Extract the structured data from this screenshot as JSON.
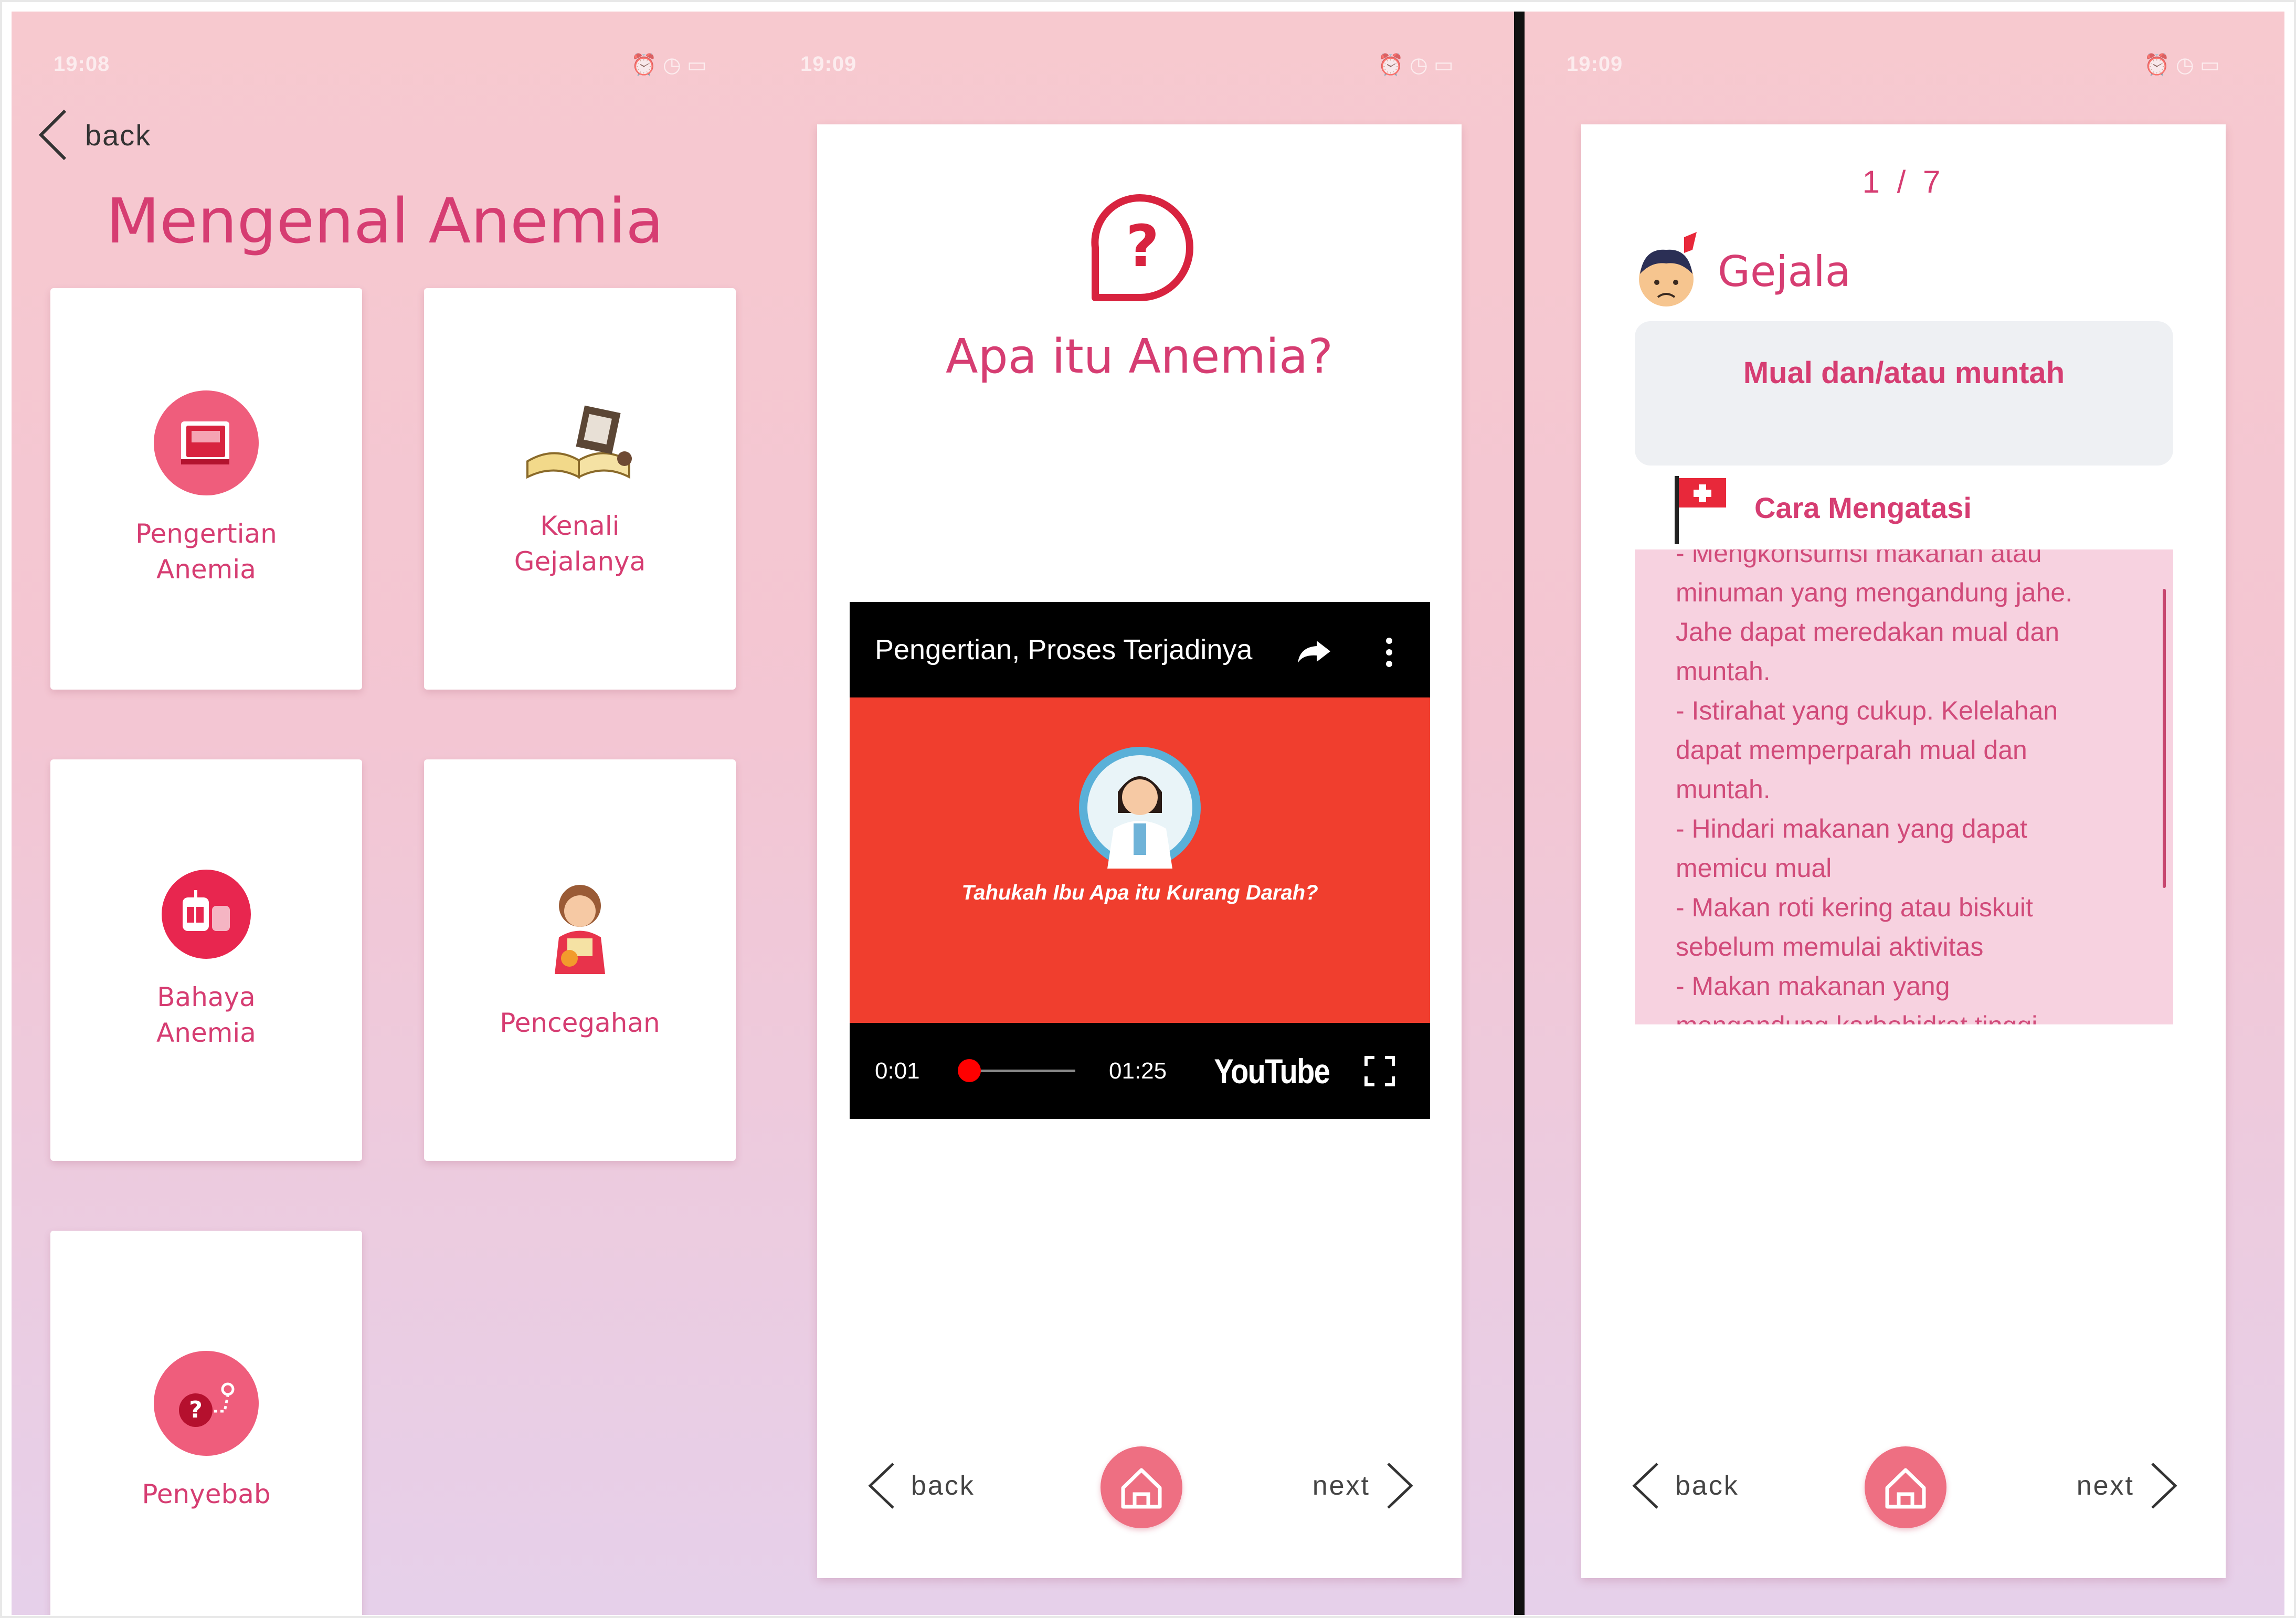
{
  "panel1": {
    "status_time": "19:08",
    "back_label": "back",
    "title": "Mengenal Anemia",
    "menu": [
      {
        "label": "Pengertian\nAnemia",
        "icon": "book-icon"
      },
      {
        "label": "Kenali\nGejalanya",
        "icon": "open-book-illustration-icon"
      },
      {
        "label": "Bahaya\nAnemia",
        "icon": "blood-bag-icon"
      },
      {
        "label": "Pencegahan",
        "icon": "girl-illustration-icon"
      },
      {
        "label": "Penyebab",
        "icon": "question-path-icon"
      }
    ]
  },
  "panel2": {
    "status_time": "19:09",
    "title": "Apa itu Anemia?",
    "video": {
      "title": "Pengertian, Proses Terjadinya",
      "thumbnail_caption": "Tahukah Ibu Apa itu Kurang Darah?",
      "current_time": "0:01",
      "duration": "01:25",
      "progress": 0.04,
      "brand": "YouTube"
    },
    "nav": {
      "back_label": "back",
      "next_label": "next"
    }
  },
  "panel3": {
    "status_time": "19:09",
    "page_counter": "1 / 7",
    "section_title": "Gejala",
    "symptom": "Mual dan/atau muntah",
    "solution_title": "Cara Mengatasi",
    "solution_text": "- Mengkonsumsi makanan atau\nminuman yang mengandung jahe.\nJahe dapat meredakan mual dan\nmuntah.\n- Istirahat yang cukup. Kelelahan\ndapat memperparah mual dan\nmuntah.\n- Hindari makanan yang dapat\nmemicu mual\n- Makan roti kering atau biskuit\nsebelum memulai aktivitas\n- Makan makanan yang\nmengandung karbohidrat tinggi",
    "nav": {
      "back_label": "back",
      "next_label": "next"
    }
  },
  "colors": {
    "accent": "#d63d72",
    "icon_circle": "#ef5d7c",
    "home_button": "#ee6f82",
    "video_red": "#f03e2e"
  }
}
